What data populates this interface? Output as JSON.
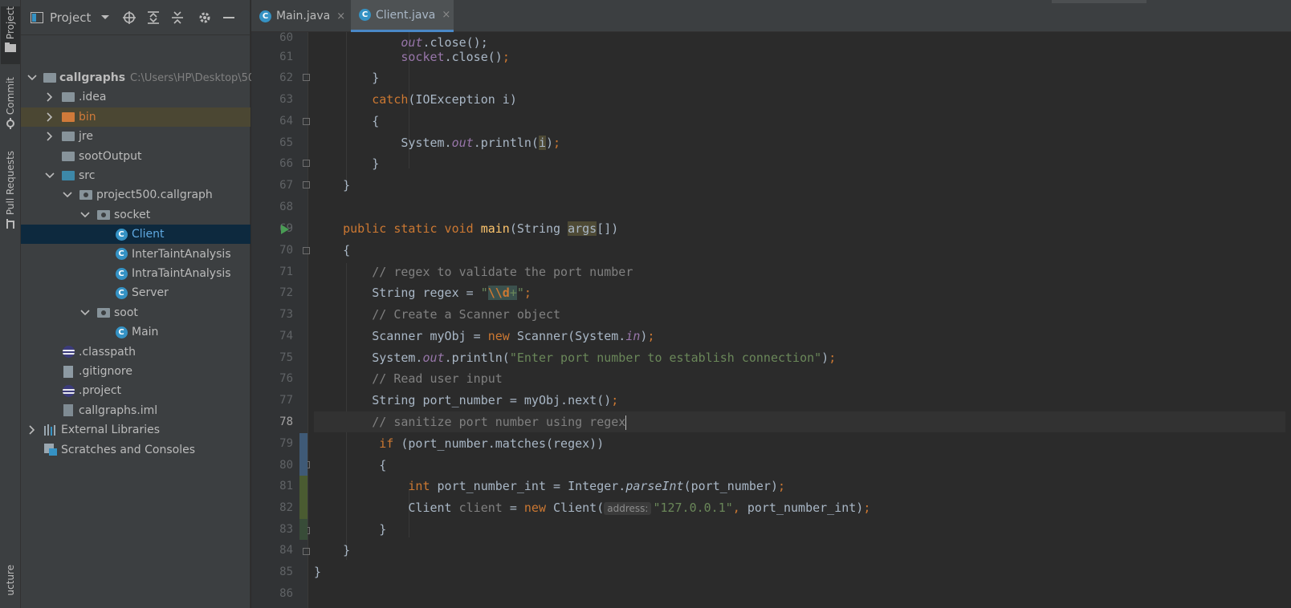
{
  "tool_strip": {
    "project_label": "Project",
    "commit_label": "Commit",
    "pull_requests_label": "Pull Requests",
    "structure_label": "ucture"
  },
  "project_panel": {
    "title": "Project",
    "tree": [
      {
        "label": "callgraphs",
        "path": "C:\\Users\\HP\\Desktop\\50",
        "icon": "folder-icon",
        "depth": 0,
        "expanded": true
      },
      {
        "label": ".idea",
        "icon": "folder-icon",
        "depth": 1,
        "expanded": false
      },
      {
        "label": "bin",
        "icon": "folder-orange-icon",
        "depth": 1,
        "expanded": false
      },
      {
        "label": "jre",
        "icon": "folder-icon",
        "depth": 1,
        "expanded": false
      },
      {
        "label": "sootOutput",
        "icon": "folder-icon",
        "depth": 1
      },
      {
        "label": "src",
        "icon": "source-folder-icon",
        "depth": 1,
        "expanded": true
      },
      {
        "label": "project500.callgraph",
        "icon": "package-icon",
        "depth": 2,
        "expanded": true
      },
      {
        "label": "socket",
        "icon": "package-icon",
        "depth": 3,
        "expanded": true
      },
      {
        "label": "Client",
        "icon": "class-icon",
        "depth": 4,
        "selected": true
      },
      {
        "label": "InterTaintAnalysis",
        "icon": "class-icon",
        "depth": 4
      },
      {
        "label": "IntraTaintAnalysis",
        "icon": "class-icon",
        "depth": 4
      },
      {
        "label": "Server",
        "icon": "class-icon",
        "depth": 4
      },
      {
        "label": "soot",
        "icon": "package-icon",
        "depth": 3,
        "expanded": true
      },
      {
        "label": "Main",
        "icon": "class-icon",
        "depth": 4
      },
      {
        "label": ".classpath",
        "icon": "eclipse-icon",
        "depth": 1
      },
      {
        "label": ".gitignore",
        "icon": "gitignore-icon",
        "depth": 1
      },
      {
        "label": ".project",
        "icon": "eclipse-icon",
        "depth": 1
      },
      {
        "label": "callgraphs.iml",
        "icon": "module-file-icon",
        "depth": 1
      },
      {
        "label": "External Libraries",
        "icon": "libraries-icon",
        "depth": 0,
        "expanded": false
      },
      {
        "label": "Scratches and Consoles",
        "icon": "scratches-icon",
        "depth": 0
      }
    ]
  },
  "tabs": [
    {
      "label": "Main.java",
      "close": "×",
      "active": false
    },
    {
      "label": "Client.java",
      "close": "×",
      "active": true
    }
  ],
  "editor": {
    "line_numbers": [
      "60",
      "61",
      "62",
      "63",
      "64",
      "65",
      "66",
      "67",
      "68",
      "69",
      "70",
      "71",
      "72",
      "73",
      "74",
      "75",
      "76",
      "77",
      "78",
      "79",
      "80",
      "81",
      "82",
      "83",
      "84",
      "85",
      "86"
    ],
    "current_line": "78",
    "hint_address": "address:",
    "code": {
      "l60_a": "out",
      "l60_b": ".close();",
      "l61_a": "socket",
      "l61_b": ".close()",
      "l61_c": ";",
      "l62": "}",
      "l63_kw": "catch",
      "l63_rest": "(IOException i)",
      "l64": "{",
      "l65_a": "System.",
      "l65_out": "out",
      "l65_b": ".println(",
      "l65_i": "i",
      "l65_c": ")",
      "l65_d": ";",
      "l66": "}",
      "l67": "}",
      "l69_kw": "public static void ",
      "l69_fn": "main",
      "l69_a": "(String ",
      "l69_args": "args",
      "l69_b": "[])",
      "l70": "{",
      "l71": "// regex to validate the port number",
      "l72_a": "String regex = ",
      "l72_q1": "\"",
      "l72_esc": "\\\\d",
      "l72_plus": "+",
      "l72_q2": "\"",
      "l72_semi": ";",
      "l73": "// Create a Scanner object",
      "l74_a": "Scanner myObj = ",
      "l74_new": "new ",
      "l74_b": "Scanner(System.",
      "l74_in": "in",
      "l74_c": ")",
      "l74_semi": ";",
      "l75_a": "System.",
      "l75_out": "out",
      "l75_b": ".println(",
      "l75_str": "\"Enter port number to establish connection\"",
      "l75_c": ")",
      "l75_semi": ";",
      "l76": "// Read user input",
      "l77_a": "String port_number = myObj.next()",
      "l77_semi": ";",
      "l78": "// sanitize port number using regex",
      "l79_kw": "if ",
      "l79_rest": "(port_number.matches(regex))",
      "l80": "{",
      "l81_kw": "int ",
      "l81_a": "port_number_int = Integer.",
      "l81_parse": "parseInt",
      "l81_b": "(port_number)",
      "l81_semi": ";",
      "l82_a": "Client ",
      "l82_var": "client",
      "l82_b": " = ",
      "l82_new": "new ",
      "l82_c": "Client(",
      "l82_str": "\"127.0.0.1\"",
      "l82_comma": ", ",
      "l82_d": "port_number_int)",
      "l82_semi": ";",
      "l83": "}",
      "l84": "}",
      "l85": "}"
    }
  }
}
